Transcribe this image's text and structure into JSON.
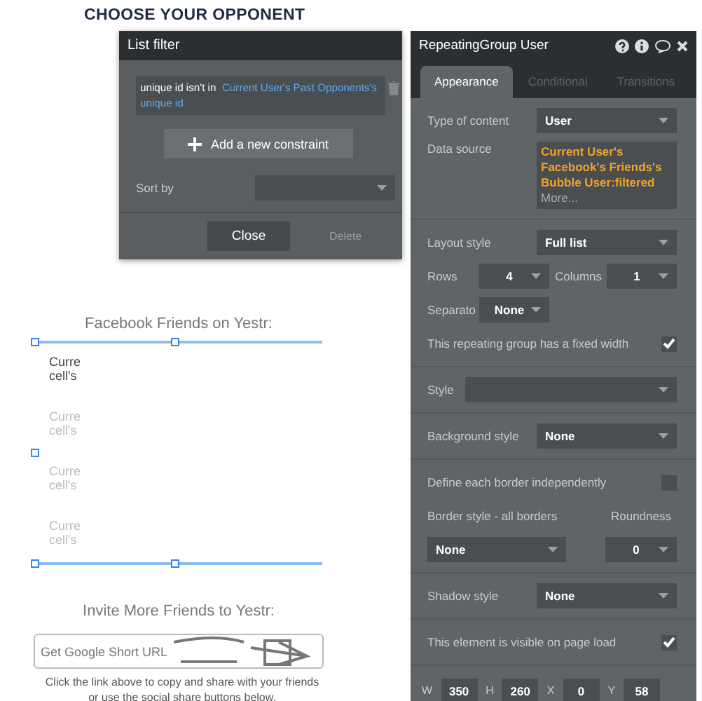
{
  "page": {
    "heading": "CHOOSE YOUR OPPONENT",
    "friends_title": "Facebook Friends on Yestr:",
    "cells": [
      {
        "text": "Curre cell's",
        "dimmed": false
      },
      {
        "text": "Curre cell's",
        "dimmed": true
      },
      {
        "text": "Curre cell's",
        "dimmed": true
      },
      {
        "text": "Curre cell's",
        "dimmed": true
      }
    ],
    "invite_title": "Invite More Friends to Yestr:",
    "url_field": {
      "placeholder": "Get Google Short URL"
    },
    "share_hint": "Click the link above to copy and share with your friends or use the social share buttons below."
  },
  "list_filter": {
    "title": "List filter",
    "constraint": {
      "label": "unique id isn't in",
      "value": "Current User's Past Opponents's unique id"
    },
    "add_button": "Add a new constraint",
    "sort_by_label": "Sort by",
    "close_button": "Close",
    "delete_button": "Delete"
  },
  "inspector": {
    "title": "RepeatingGroup User",
    "tabs": [
      {
        "label": "Appearance",
        "selected": true
      },
      {
        "label": "Conditional",
        "selected": false
      },
      {
        "label": "Transitions",
        "selected": false
      }
    ],
    "type_of_content": {
      "label": "Type of content",
      "value": "User"
    },
    "data_source": {
      "label": "Data source",
      "value": "Current User's Facebook's Friends's Bubble User:filtered",
      "more": "More..."
    },
    "layout_style": {
      "label": "Layout style",
      "value": "Full list"
    },
    "rows": {
      "label": "Rows",
      "value": "4"
    },
    "columns": {
      "label": "Columns",
      "value": "1"
    },
    "separator": {
      "label": "Separato",
      "value": "None"
    },
    "fixed_width": {
      "label": "This repeating group has a fixed width",
      "checked": true
    },
    "style": {
      "label": "Style"
    },
    "background_style": {
      "label": "Background style",
      "value": "None"
    },
    "define_borders": {
      "label": "Define each border independently",
      "checked": false
    },
    "border_style": {
      "label": "Border style - all borders",
      "value": "None"
    },
    "roundness": {
      "label": "Roundness",
      "value": "0"
    },
    "shadow_style": {
      "label": "Shadow style",
      "value": "None"
    },
    "visible_on_load": {
      "label": "This element is visible on page load",
      "checked": true
    },
    "geometry": [
      {
        "label": "W",
        "value": "350"
      },
      {
        "label": "H",
        "value": "260"
      },
      {
        "label": "X",
        "value": "0"
      },
      {
        "label": "Y",
        "value": "58"
      }
    ]
  }
}
